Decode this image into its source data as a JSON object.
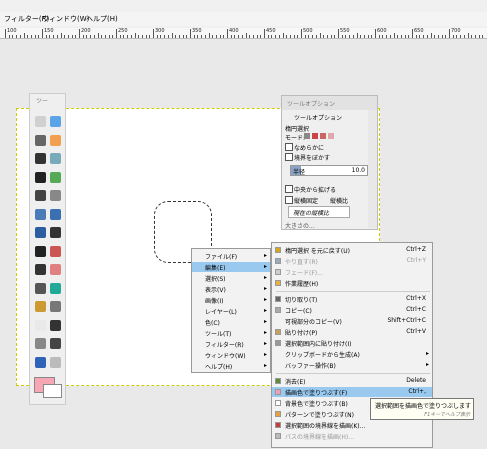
{
  "menubar": {
    "items": [
      "フィルター(R)",
      "ウィンドウ(W)",
      "ヘルプ(H)"
    ]
  },
  "ruler": {
    "labels": [
      "100",
      "150",
      "200",
      "250",
      "300",
      "350",
      "400",
      "450",
      "500",
      "550",
      "600",
      "650",
      "700"
    ]
  },
  "toolbox": {
    "title": "ツー"
  },
  "tool_options": {
    "title": "ツールオプション",
    "tab": "ツールオプション",
    "section": "楕円選択",
    "mode_label": "モード:",
    "antialias": "なめらかに",
    "feather": "境界をぼかす",
    "radius_label": "半径",
    "radius_value": "10.0",
    "expand_center": "中央から拡げる",
    "fixed": "縦横固定",
    "fixed_option": "縦横比",
    "current_ratio": "現在の縦横比",
    "partial": "大きさの..."
  },
  "context_menu": {
    "items": [
      {
        "label": "ファイル(F)",
        "submenu": true
      },
      {
        "label": "編集(E)",
        "submenu": true,
        "highlighted": true
      },
      {
        "label": "選択(S)",
        "submenu": true
      },
      {
        "label": "表示(V)",
        "submenu": true
      },
      {
        "label": "画像(I)",
        "submenu": true
      },
      {
        "label": "レイヤー(L)",
        "submenu": true
      },
      {
        "label": "色(C)",
        "submenu": true
      },
      {
        "label": "ツール(T)",
        "submenu": true
      },
      {
        "label": "フィルター(R)",
        "submenu": true
      },
      {
        "label": "ウィンドウ(W)",
        "submenu": true
      },
      {
        "label": "ヘルプ(H)",
        "submenu": true
      }
    ]
  },
  "edit_menu": {
    "items": [
      {
        "label": "楕円選択 を元に戻す(U)",
        "accel": "Ctrl+Z",
        "icon": "undo-icon",
        "color": "#d9a520"
      },
      {
        "label": "やり直す(R)",
        "accel": "Ctrl+Y",
        "icon": "redo-icon",
        "disabled": true,
        "color": "#9ab"
      },
      {
        "label": "フェード(F)...",
        "disabled": true,
        "icon": "fade-icon",
        "color": "#ccc"
      },
      {
        "label": "作業履歴(H)",
        "icon": "history-icon",
        "color": "#e8b040"
      },
      {
        "sep": true
      },
      {
        "label": "切り取り(T)",
        "accel": "Ctrl+X",
        "icon": "cut-icon",
        "color": "#666"
      },
      {
        "label": "コピー(C)",
        "accel": "Ctrl+C",
        "icon": "copy-icon",
        "color": "#aaa"
      },
      {
        "label": "可視部分のコピー(V)",
        "accel": "Shift+Ctrl+C",
        "icon": "",
        "color": ""
      },
      {
        "label": "貼り付け(P)",
        "accel": "Ctrl+V",
        "icon": "paste-icon",
        "color": "#c9a060"
      },
      {
        "label": "選択範囲内に貼り付け(I)",
        "icon": "paste-into-icon",
        "color": "#999"
      },
      {
        "label": "クリップボードから生成(A)",
        "submenu": true,
        "icon": "",
        "color": ""
      },
      {
        "label": "バッファー操作(B)",
        "submenu": true,
        "icon": "",
        "color": ""
      },
      {
        "sep": true
      },
      {
        "label": "消去(E)",
        "accel": "Delete",
        "icon": "clear-icon",
        "color": "#5a8a3a"
      },
      {
        "label": "描画色で塗りつぶす(F)",
        "accel": "Ctrl+,",
        "highlighted": true,
        "icon": "fill-fg-icon",
        "color": "#f0a0b0"
      },
      {
        "label": "背景色で塗りつぶす(B)",
        "icon": "fill-bg-icon",
        "color": "#ffffff"
      },
      {
        "label": "パターンで塗りつぶす(N)",
        "icon": "fill-pattern-icon",
        "color": "#e8a040"
      },
      {
        "label": "選択範囲の境界線を描画(K)...",
        "icon": "stroke-selection-icon",
        "color": "#c04040"
      },
      {
        "label": "パスの境界線を描画(H)...",
        "disabled": true,
        "icon": "stroke-path-icon",
        "color": "#bbb"
      }
    ]
  },
  "tooltip": {
    "text": "選択範囲を描画色で塗りつぶします",
    "hint": "F1キーでヘルプ表示"
  },
  "colors": {
    "fg": "#f6a7b3",
    "bg": "#ffffff",
    "highlight": "#99c9ef"
  }
}
